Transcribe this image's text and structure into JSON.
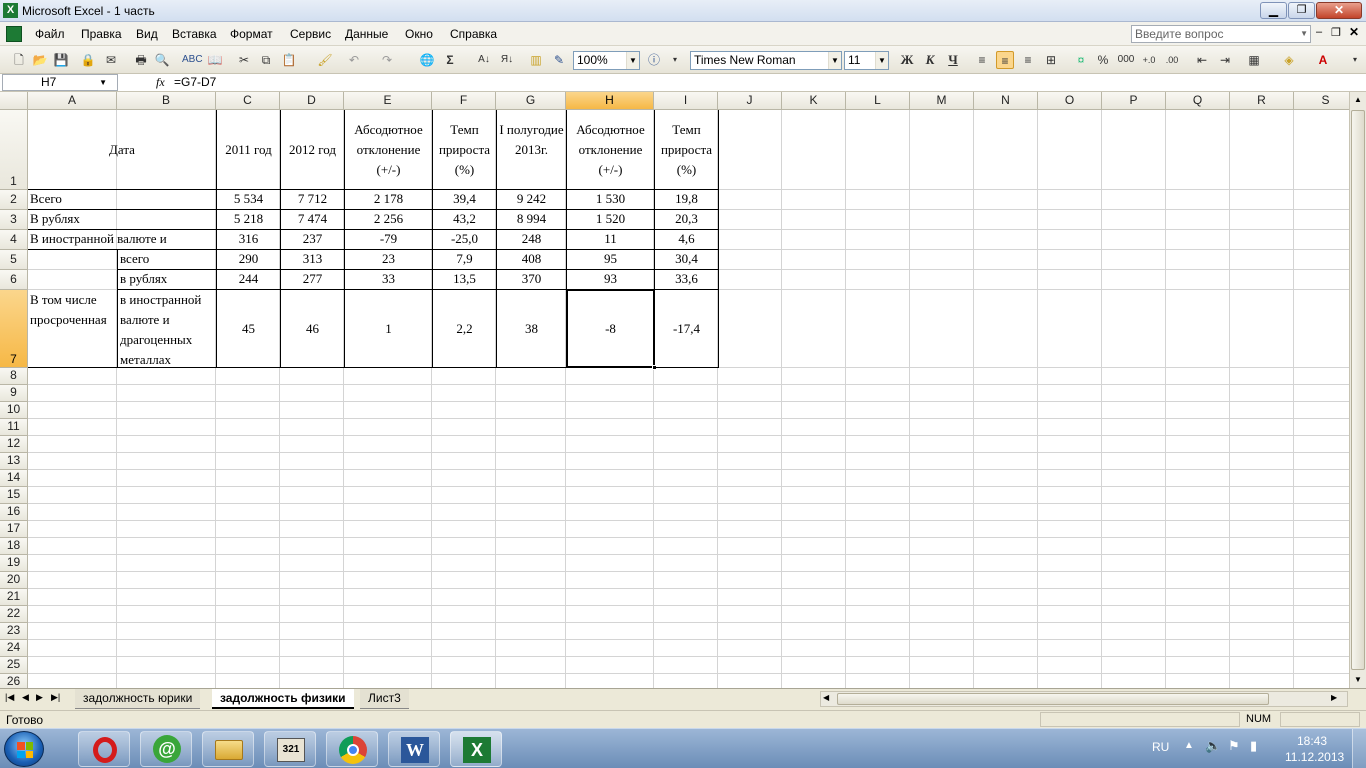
{
  "window": {
    "title": "Microsoft Excel - 1 часть",
    "help_placeholder": "Введите вопрос"
  },
  "menu": [
    "Файл",
    "Правка",
    "Вид",
    "Вставка",
    "Формат",
    "Сервис",
    "Данные",
    "Окно",
    "Справка"
  ],
  "toolbar": {
    "zoom": "100%",
    "font_name": "Times New Roman",
    "font_size": "11",
    "bold_label": "Ж",
    "italic_label": "К",
    "underline_label": "Ч",
    "percent_label": "%",
    "thousands_label": "000"
  },
  "formula_bar": {
    "name_box": "H7",
    "fx": "fx",
    "formula": "=G7-D7"
  },
  "columns": [
    "A",
    "B",
    "C",
    "D",
    "E",
    "F",
    "G",
    "H",
    "I",
    "J",
    "K",
    "L",
    "M",
    "N",
    "O",
    "P",
    "Q",
    "R",
    "S"
  ],
  "selected_column": "H",
  "rows": [
    "1",
    "2",
    "3",
    "4",
    "5",
    "6",
    "7",
    "8",
    "9",
    "10",
    "11",
    "12",
    "13",
    "14",
    "15",
    "16",
    "17",
    "18",
    "19",
    "20",
    "21",
    "22",
    "23",
    "24",
    "25",
    "26"
  ],
  "selected_row": "7",
  "table": {
    "headers": {
      "A": "Дата",
      "C": "2011 год",
      "D": "2012 год",
      "E": "Абсодютное отклонение (+/-)",
      "F": "Темп прироста (%)",
      "G": "I полугодие 2013г.",
      "H": "Абсодютное отклонение (+/-)",
      "I": "Темп прироста (%)"
    },
    "r2": {
      "label": "Всего",
      "C": "5 534",
      "D": "7 712",
      "E": "2 178",
      "F": "39,4",
      "G": "9 242",
      "H": "1 530",
      "I": "19,8"
    },
    "r3": {
      "label": "В рублях",
      "C": "5 218",
      "D": "7 474",
      "E": "2 256",
      "F": "43,2",
      "G": "8 994",
      "H": "1 520",
      "I": "20,3"
    },
    "r4": {
      "label": "В иностранной валюте и",
      "C": "316",
      "D": "237",
      "E": "-79",
      "F": "-25,0",
      "G": "248",
      "H": "11",
      "I": "4,6"
    },
    "r5": {
      "label": "всего",
      "C": "290",
      "D": "313",
      "E": "23",
      "F": "7,9",
      "G": "408",
      "H": "95",
      "I": "30,4"
    },
    "r6": {
      "label": "в рублях",
      "C": "244",
      "D": "277",
      "E": "33",
      "F": "13,5",
      "G": "370",
      "H": "93",
      "I": "33,6"
    },
    "r7": {
      "label": "в иностранной валюте и драгоценных металлах",
      "C": "45",
      "D": "46",
      "E": "1",
      "F": "2,2",
      "G": "38",
      "H": "-8",
      "I": "-17,4"
    },
    "merged_A": "В том числе просроченная"
  },
  "sheets": [
    "задолжность юрики",
    "задолжность физики",
    "Лист3"
  ],
  "active_sheet": "задолжность физики",
  "status": {
    "ready": "Готово",
    "num": "NUM"
  },
  "taskbar": {
    "lang": "RU",
    "time": "18:43",
    "date": "11.12.2013",
    "apps": [
      "start-orb",
      "opera",
      "at-client",
      "file-manager",
      "total-commander",
      "chrome",
      "word",
      "excel"
    ]
  },
  "colors": {
    "selection_header": "#f6b846",
    "grid": "#d4d4d4",
    "excel_green": "#1d7a34"
  }
}
